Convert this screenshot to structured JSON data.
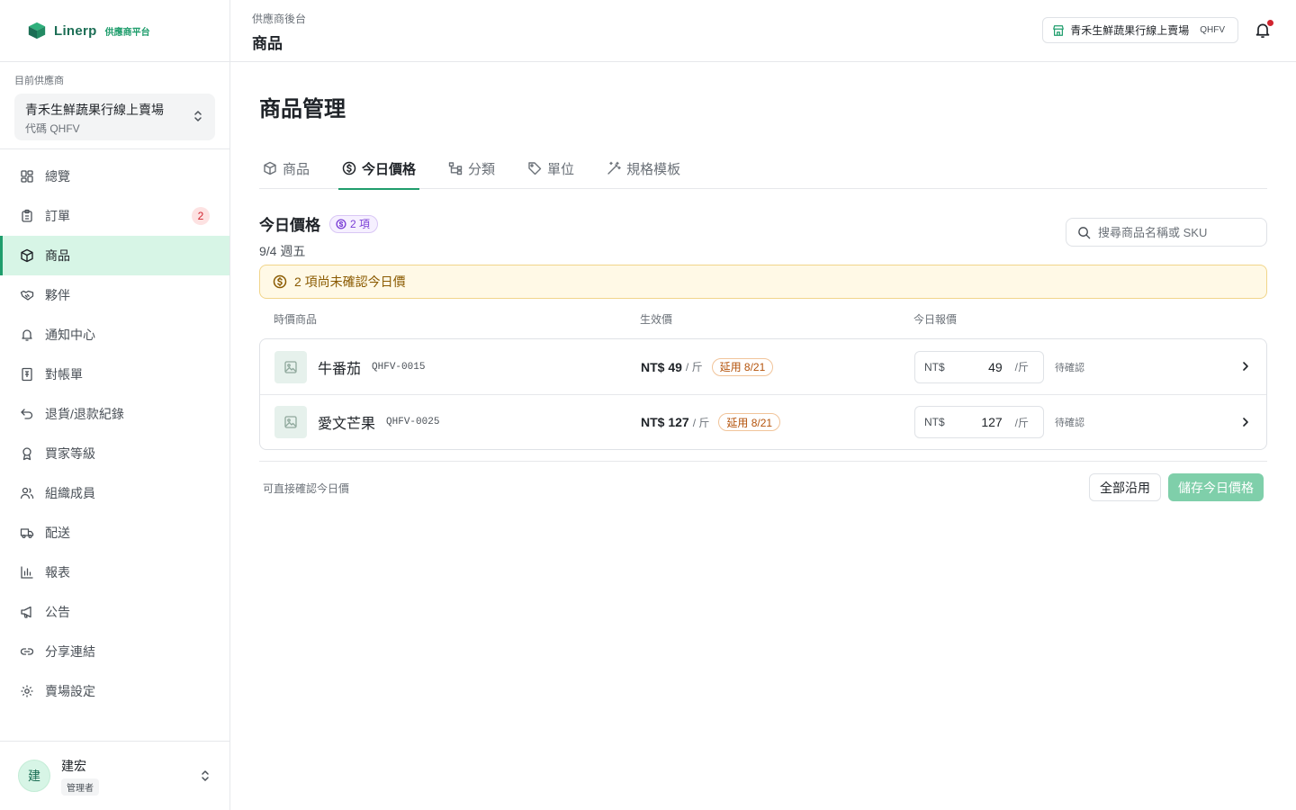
{
  "brand": {
    "name": "Linerp",
    "tag": "供應商平台"
  },
  "vendor": {
    "caption": "目前供應商",
    "name": "青禾生鮮蔬果行線上賣場",
    "code": "代碼 QHFV"
  },
  "nav": {
    "items": [
      {
        "label": "總覽",
        "icon": "grid-icon"
      },
      {
        "label": "訂單",
        "icon": "clipboard-icon",
        "badge": "2"
      },
      {
        "label": "商品",
        "icon": "box-icon",
        "active": true
      },
      {
        "label": "夥伴",
        "icon": "handshake-icon"
      },
      {
        "label": "通知中心",
        "icon": "bell-icon"
      },
      {
        "label": "對帳單",
        "icon": "receipt-icon"
      },
      {
        "label": "退貨/退款紀錄",
        "icon": "undo-icon"
      },
      {
        "label": "買家等級",
        "icon": "award-icon"
      },
      {
        "label": "組織成員",
        "icon": "users-icon"
      },
      {
        "label": "配送",
        "icon": "truck-icon"
      },
      {
        "label": "報表",
        "icon": "bar-chart-icon"
      },
      {
        "label": "公告",
        "icon": "megaphone-icon"
      },
      {
        "label": "分享連結",
        "icon": "link-icon"
      },
      {
        "label": "賣場設定",
        "icon": "gear-icon"
      }
    ]
  },
  "user": {
    "initial": "建",
    "name": "建宏",
    "role": "管理者"
  },
  "header": {
    "breadcrumb": "供應商後台",
    "title": "商品",
    "store_name": "青禾生鮮蔬果行線上賣場",
    "store_code": "QHFV"
  },
  "page": {
    "title": "商品管理",
    "tabs": [
      {
        "label": "商品",
        "icon": "box-icon"
      },
      {
        "label": "今日價格",
        "icon": "dollar-circle-icon",
        "active": true
      },
      {
        "label": "分類",
        "icon": "tree-icon"
      },
      {
        "label": "單位",
        "icon": "tag-icon"
      },
      {
        "label": "規格模板",
        "icon": "wand-icon"
      }
    ]
  },
  "section": {
    "title": "今日價格",
    "count": "2 項",
    "date": "9/4 週五",
    "search_placeholder": "搜尋商品名稱或 SKU",
    "alert": "2 項尚未確認今日價"
  },
  "table": {
    "headers": {
      "product": "時價商品",
      "effective": "生效價",
      "quote": "今日報價"
    },
    "rows": [
      {
        "name": "牛番茄",
        "sku": "QHFV-0015",
        "effective_price": "NT$ 49",
        "unit": "/ 斤",
        "extend": "延用 8/21",
        "currency": "NT$",
        "quote": "49",
        "quote_unit": "/斤",
        "status": "待確認"
      },
      {
        "name": "愛文芒果",
        "sku": "QHFV-0025",
        "effective_price": "NT$ 127",
        "unit": "/ 斤",
        "extend": "延用 8/21",
        "currency": "NT$",
        "quote": "127",
        "quote_unit": "/斤",
        "status": "待確認"
      }
    ]
  },
  "footer": {
    "note": "可直接確認今日價",
    "apply_all": "全部沿用",
    "save": "儲存今日價格"
  },
  "colors": {
    "accent": "#1f9d6c",
    "active_bg": "#d7f5e6",
    "alert_bg": "#fff9e6",
    "danger": "#d1242f"
  }
}
